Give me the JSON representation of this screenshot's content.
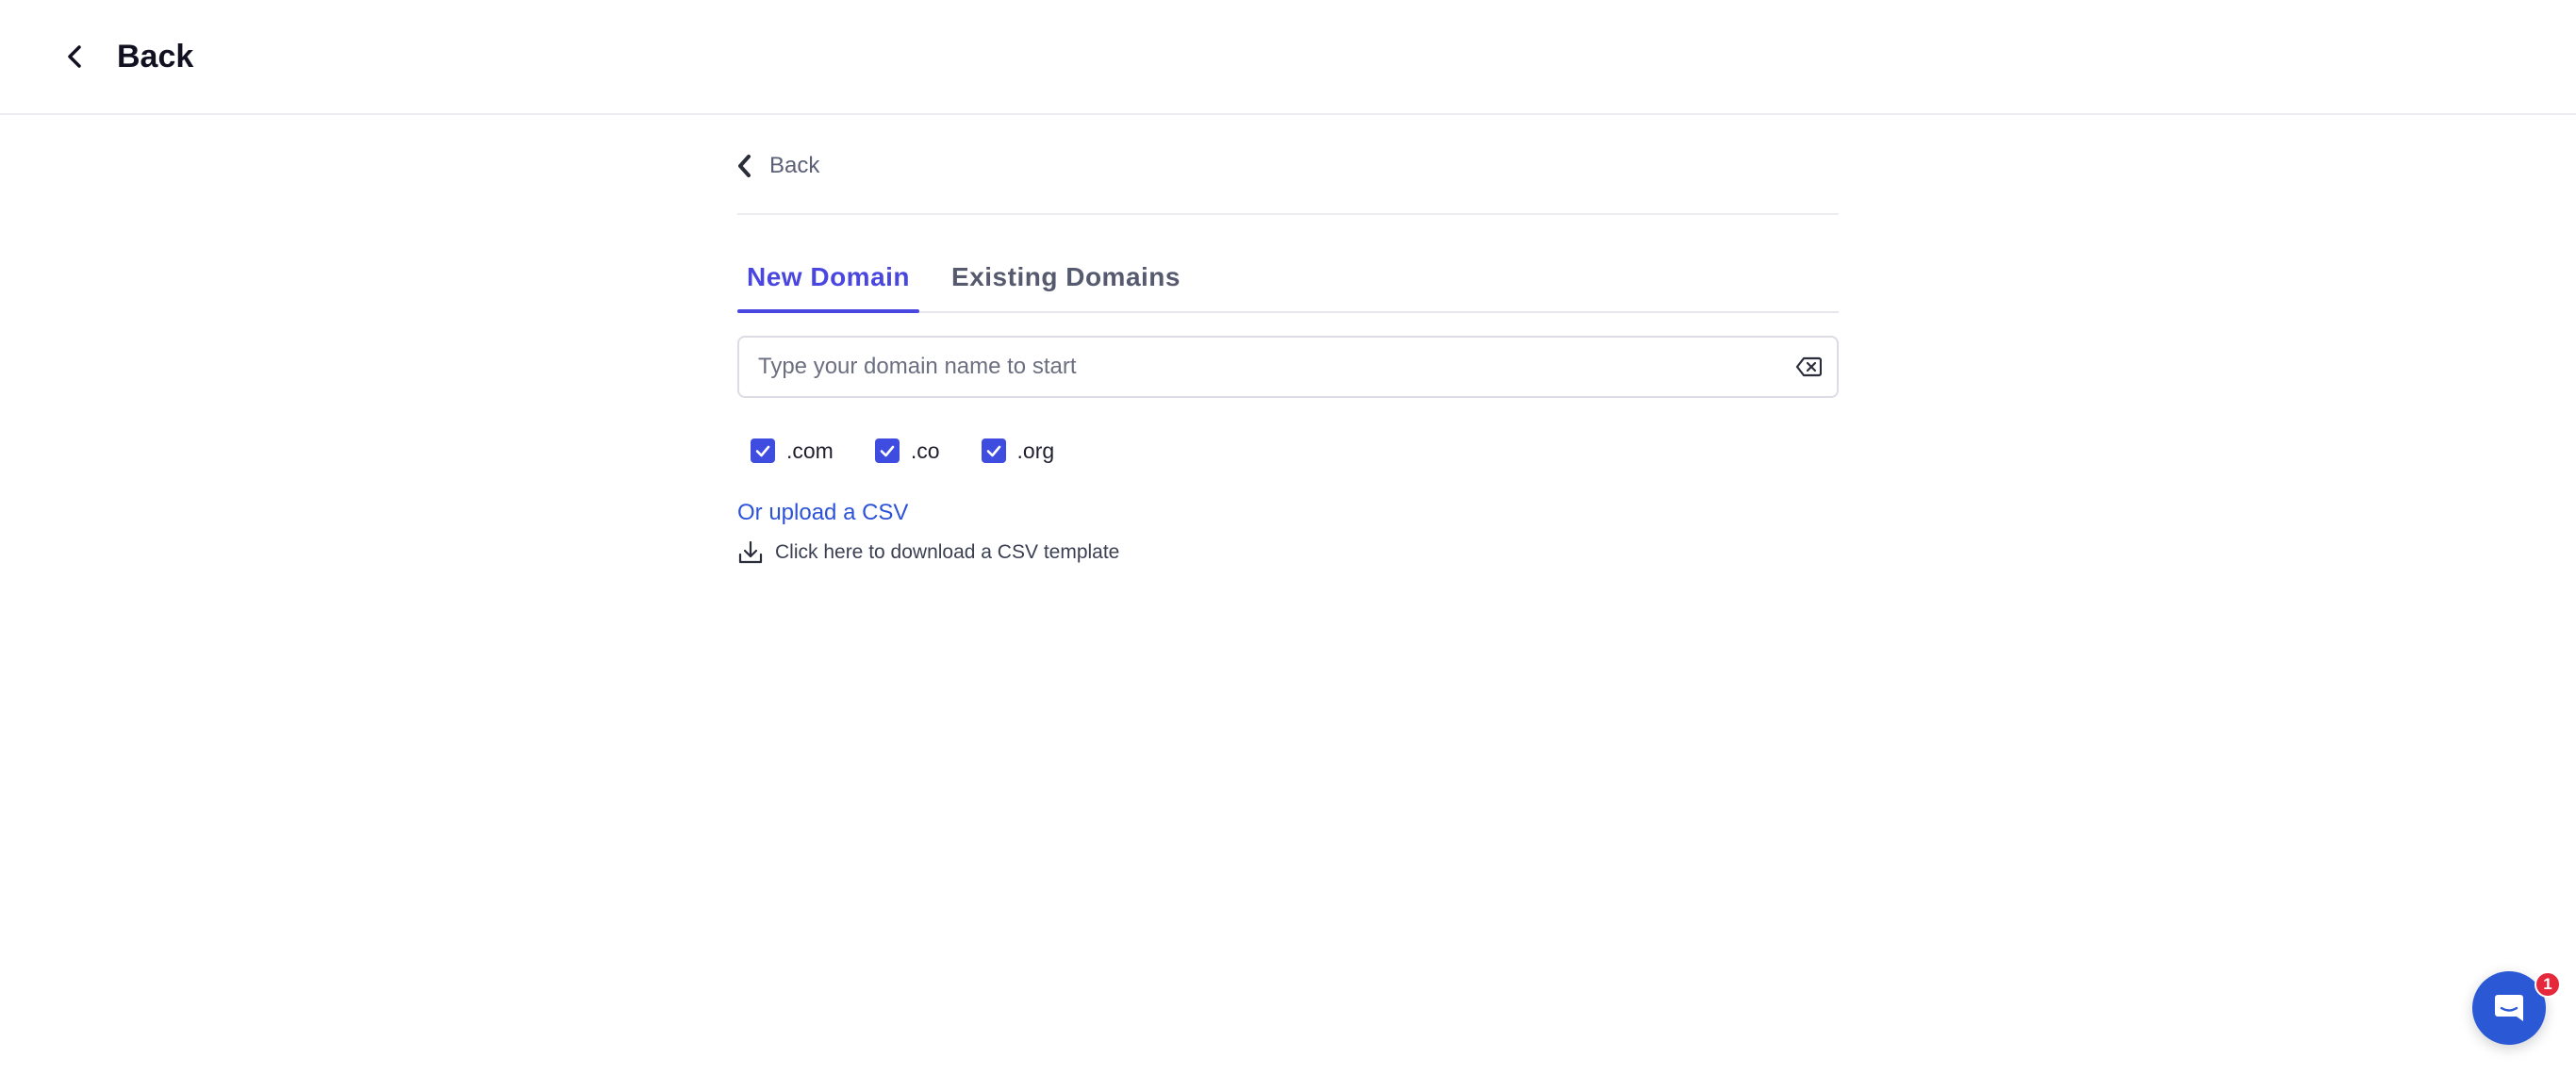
{
  "header": {
    "back_label": "Back"
  },
  "sub_nav": {
    "back_label": "Back"
  },
  "tabs": [
    {
      "label": "New Domain",
      "active": true
    },
    {
      "label": "Existing Domains",
      "active": false
    }
  ],
  "search": {
    "placeholder": "Type your domain name to start",
    "value": ""
  },
  "tlds": [
    {
      "label": ".com",
      "checked": true
    },
    {
      "label": ".co",
      "checked": true
    },
    {
      "label": ".org",
      "checked": true
    }
  ],
  "csv": {
    "upload_label": "Or upload a CSV",
    "download_label": "Click here to download a CSV template"
  },
  "chat": {
    "badge_count": "1"
  },
  "colors": {
    "accent": "#4a47e0",
    "checkbox": "#3f4ce0",
    "link": "#2c52d8",
    "chat": "#2b59d6",
    "badge": "#e5283b"
  },
  "icons": {
    "header_back": "chevron-left-icon",
    "sub_back": "chevron-left-icon",
    "clear": "backspace-icon",
    "download": "download-icon",
    "chat": "chat-icon",
    "check": "check-icon"
  }
}
